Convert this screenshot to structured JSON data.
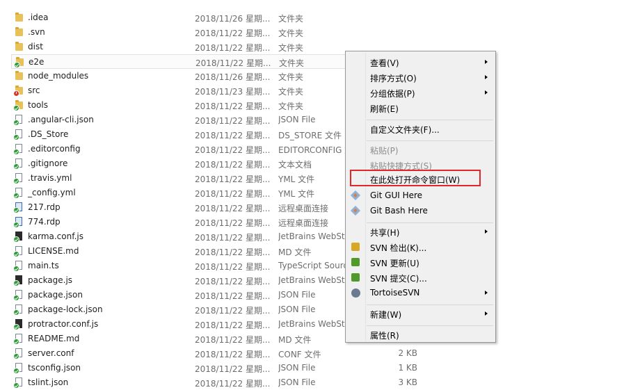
{
  "files": [
    {
      "name": ".idea",
      "date": "2018/11/26 星期...",
      "type": "文件夹",
      "size": "",
      "icon": "folder-icon",
      "badge": ""
    },
    {
      "name": ".svn",
      "date": "2018/11/22 星期...",
      "type": "文件夹",
      "size": "",
      "icon": "folder-icon",
      "badge": ""
    },
    {
      "name": "dist",
      "date": "2018/11/22 星期...",
      "type": "文件夹",
      "size": "",
      "icon": "folder-icon",
      "badge": ""
    },
    {
      "name": "e2e",
      "date": "2018/11/22 星期...",
      "type": "文件夹",
      "size": "",
      "icon": "folder-icon",
      "badge": "ok"
    },
    {
      "name": "node_modules",
      "date": "2018/11/26 星期...",
      "type": "文件夹",
      "size": "",
      "icon": "folder-icon",
      "badge": ""
    },
    {
      "name": "src",
      "date": "2018/11/23 星期...",
      "type": "文件夹",
      "size": "",
      "icon": "folder-icon",
      "badge": "modified"
    },
    {
      "name": "tools",
      "date": "2018/11/22 星期...",
      "type": "文件夹",
      "size": "",
      "icon": "folder-icon",
      "badge": "ok"
    },
    {
      "name": ".angular-cli.json",
      "date": "2018/11/22 星期...",
      "type": "JSON File",
      "size": "",
      "icon": "file-icon",
      "badge": "ok"
    },
    {
      "name": ".DS_Store",
      "date": "2018/11/22 星期...",
      "type": "DS_STORE 文件",
      "size": "",
      "icon": "file-icon",
      "badge": "ok"
    },
    {
      "name": ".editorconfig",
      "date": "2018/11/22 星期...",
      "type": "EDITORCONFIG 文件",
      "size": "",
      "icon": "file-icon",
      "badge": "ok"
    },
    {
      "name": ".gitignore",
      "date": "2018/11/22 星期...",
      "type": "文本文档",
      "size": "",
      "icon": "file-icon",
      "badge": "ok"
    },
    {
      "name": ".travis.yml",
      "date": "2018/11/22 星期...",
      "type": "YML 文件",
      "size": "",
      "icon": "file-icon",
      "badge": "ok"
    },
    {
      "name": "_config.yml",
      "date": "2018/11/22 星期...",
      "type": "YML 文件",
      "size": "",
      "icon": "file-icon",
      "badge": "ok"
    },
    {
      "name": "217.rdp",
      "date": "2018/11/22 星期...",
      "type": "远程桌面连接",
      "size": "",
      "icon": "rdp-icon",
      "badge": "ok"
    },
    {
      "name": "774.rdp",
      "date": "2018/11/22 星期...",
      "type": "远程桌面连接",
      "size": "",
      "icon": "rdp-icon",
      "badge": "ok"
    },
    {
      "name": "karma.conf.js",
      "date": "2018/11/22 星期...",
      "type": "JetBrains WebStorm",
      "size": "",
      "icon": "webstorm-icon",
      "badge": "ok"
    },
    {
      "name": "LICENSE.md",
      "date": "2018/11/22 星期...",
      "type": "MD 文件",
      "size": "",
      "icon": "file-icon",
      "badge": "ok"
    },
    {
      "name": "main.ts",
      "date": "2018/11/22 星期...",
      "type": "TypeScript Source",
      "size": "",
      "icon": "file-icon",
      "badge": "ok"
    },
    {
      "name": "package.js",
      "date": "2018/11/22 星期...",
      "type": "JetBrains WebStorm",
      "size": "",
      "icon": "webstorm-icon",
      "badge": "ok"
    },
    {
      "name": "package.json",
      "date": "2018/11/22 星期...",
      "type": "JSON File",
      "size": "",
      "icon": "file-icon",
      "badge": "ok"
    },
    {
      "name": "package-lock.json",
      "date": "2018/11/22 星期...",
      "type": "JSON File",
      "size": "",
      "icon": "file-icon",
      "badge": "ok"
    },
    {
      "name": "protractor.conf.js",
      "date": "2018/11/22 星期...",
      "type": "JetBrains WebStorm",
      "size": "",
      "icon": "webstorm-icon",
      "badge": "ok"
    },
    {
      "name": "README.md",
      "date": "2018/11/22 星期...",
      "type": "MD 文件",
      "size": "",
      "icon": "file-icon",
      "badge": "ok"
    },
    {
      "name": "server.conf",
      "date": "2018/11/22 星期...",
      "type": "CONF 文件",
      "size": "2 KB",
      "icon": "file-icon",
      "badge": "ok"
    },
    {
      "name": "tsconfig.json",
      "date": "2018/11/22 星期...",
      "type": "JSON File",
      "size": "1 KB",
      "icon": "file-icon",
      "badge": "ok"
    },
    {
      "name": "tslint.json",
      "date": "2018/11/22 星期...",
      "type": "JSON File",
      "size": "3 KB",
      "icon": "file-icon",
      "badge": "ok"
    }
  ],
  "selected_row_index": 3,
  "context_menu": {
    "items": [
      {
        "label": "查看(V)",
        "submenu": true,
        "enabled": true,
        "icon": ""
      },
      {
        "label": "排序方式(O)",
        "submenu": true,
        "enabled": true,
        "icon": ""
      },
      {
        "label": "分组依据(P)",
        "submenu": true,
        "enabled": true,
        "icon": ""
      },
      {
        "label": "刷新(E)",
        "submenu": false,
        "enabled": true,
        "icon": ""
      },
      {
        "sep": true
      },
      {
        "label": "自定义文件夹(F)...",
        "submenu": false,
        "enabled": true,
        "icon": ""
      },
      {
        "sep": true
      },
      {
        "label": "粘贴(P)",
        "submenu": false,
        "enabled": false,
        "icon": ""
      },
      {
        "label": "粘贴快捷方式(S)",
        "submenu": false,
        "enabled": false,
        "icon": ""
      },
      {
        "label": "在此处打开命令窗口(W)",
        "submenu": false,
        "enabled": true,
        "icon": "",
        "highlighted": true
      },
      {
        "label": "Git GUI Here",
        "submenu": false,
        "enabled": true,
        "icon": "git-icon"
      },
      {
        "label": "Git Bash Here",
        "submenu": false,
        "enabled": true,
        "icon": "git-icon"
      },
      {
        "sep": true
      },
      {
        "label": "共享(H)",
        "submenu": true,
        "enabled": true,
        "icon": ""
      },
      {
        "label": "SVN 检出(K)...",
        "submenu": false,
        "enabled": true,
        "icon": "svn-checkout-icon"
      },
      {
        "label": "SVN 更新(U)",
        "submenu": false,
        "enabled": true,
        "icon": "svn-update-icon"
      },
      {
        "label": "SVN 提交(C)...",
        "submenu": false,
        "enabled": true,
        "icon": "svn-commit-icon"
      },
      {
        "label": "TortoiseSVN",
        "submenu": true,
        "enabled": true,
        "icon": "tortoisesvn-icon"
      },
      {
        "sep": true
      },
      {
        "label": "新建(W)",
        "submenu": true,
        "enabled": true,
        "icon": ""
      },
      {
        "sep": true
      },
      {
        "label": "属性(R)",
        "submenu": false,
        "enabled": true,
        "icon": ""
      }
    ]
  },
  "colors": {
    "highlight_box": "#e0262a",
    "folder": "#e8c159",
    "svn_ok": "#2e9b3a",
    "svn_modified": "#d63a2a"
  }
}
